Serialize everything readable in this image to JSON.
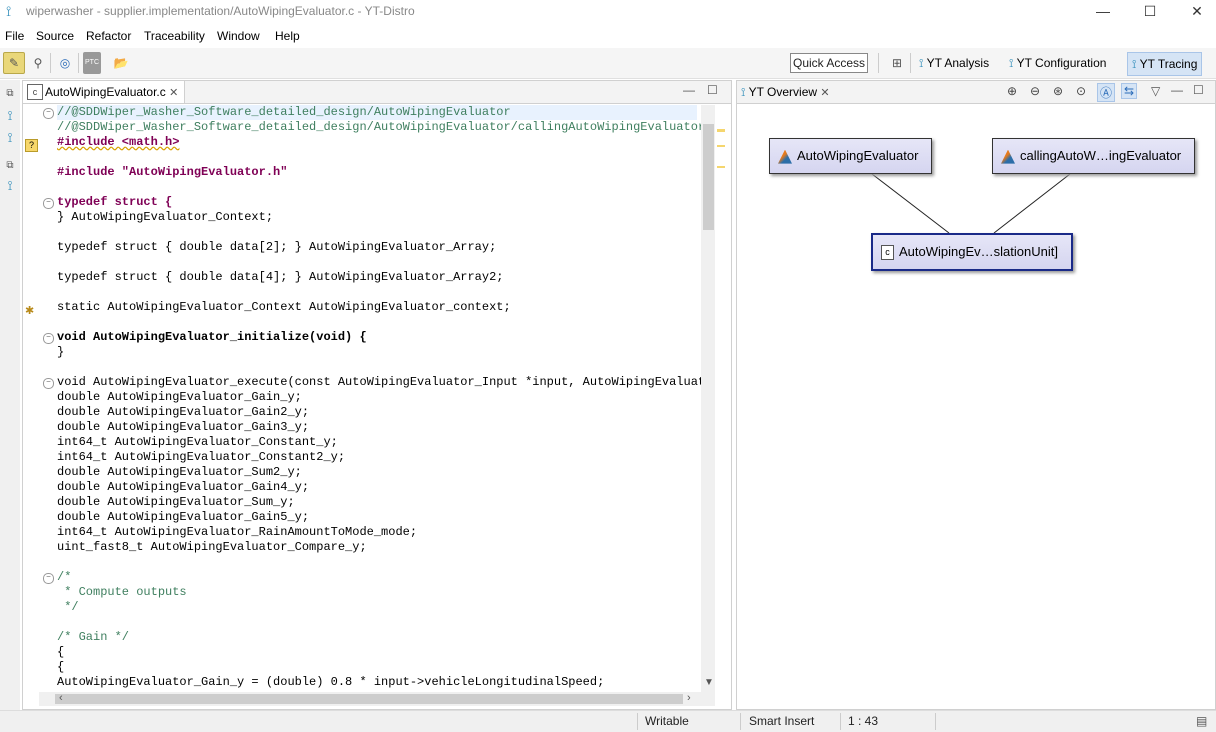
{
  "window": {
    "title": "wiperwasher - supplier.implementation/AutoWipingEvaluator.c - YT-Distro",
    "minimize": "—",
    "maximize": "☐",
    "close": "✕"
  },
  "menu": [
    "File",
    "Source",
    "Refactor",
    "Traceability",
    "Window",
    "Help"
  ],
  "toolbar": {
    "quick_access": "Quick Access",
    "perspectives": [
      "YT Analysis",
      "YT Configuration",
      "YT Tracing"
    ],
    "ptc_label": "PTC"
  },
  "editor": {
    "tab_label": "AutoWipingEvaluator.c",
    "code_lines": [
      "//@SDDWiper_Washer_Software_detailed_design/AutoWipingEvaluator",
      "//@SDDWiper_Washer_Software_detailed_design/AutoWipingEvaluator/callingAutoWipingEvaluator",
      "#include <math.h>",
      "",
      "#include \"AutoWipingEvaluator.h\"",
      "",
      "typedef struct {",
      "} AutoWipingEvaluator_Context;",
      "",
      "typedef struct { double data[2]; } AutoWipingEvaluator_Array;",
      "",
      "typedef struct { double data[4]; } AutoWipingEvaluator_Array2;",
      "",
      "static AutoWipingEvaluator_Context AutoWipingEvaluator_context;",
      "",
      "void AutoWipingEvaluator_initialize(void) {",
      "}",
      "",
      "",
      "void AutoWipingEvaluator_execute(const AutoWipingEvaluator_Input *input, AutoWipingEvaluator",
      "double AutoWipingEvaluator_Gain_y;",
      "double AutoWipingEvaluator_Gain2_y;",
      "double AutoWipingEvaluator_Gain3_y;",
      "int64_t AutoWipingEvaluator_Constant_y;",
      "int64_t AutoWipingEvaluator_Constant2_y;",
      "double AutoWipingEvaluator_Sum2_y;",
      "double AutoWipingEvaluator_Gain4_y;",
      "double AutoWipingEvaluator_Sum_y;",
      "double AutoWipingEvaluator_Gain5_y;",
      "int64_t AutoWipingEvaluator_RainAmountToMode_mode;",
      "uint_fast8_t AutoWipingEvaluator_Compare_y;",
      "",
      "/*",
      " * Compute outputs",
      " */",
      "",
      "/* Gain */",
      "{",
      "{",
      "AutoWipingEvaluator_Gain_y = (double) 0.8 * input->vehicleLongitudinalSpeed;"
    ]
  },
  "overview": {
    "tab_label": "YT Overview",
    "nodes": {
      "a": "AutoWipingEvaluator",
      "b": "callingAutoW…ingEvaluator",
      "c": "AutoWipingEv…slationUnit]"
    }
  },
  "status": {
    "mode": "Writable",
    "insert": "Smart Insert",
    "position": "1 : 43"
  }
}
